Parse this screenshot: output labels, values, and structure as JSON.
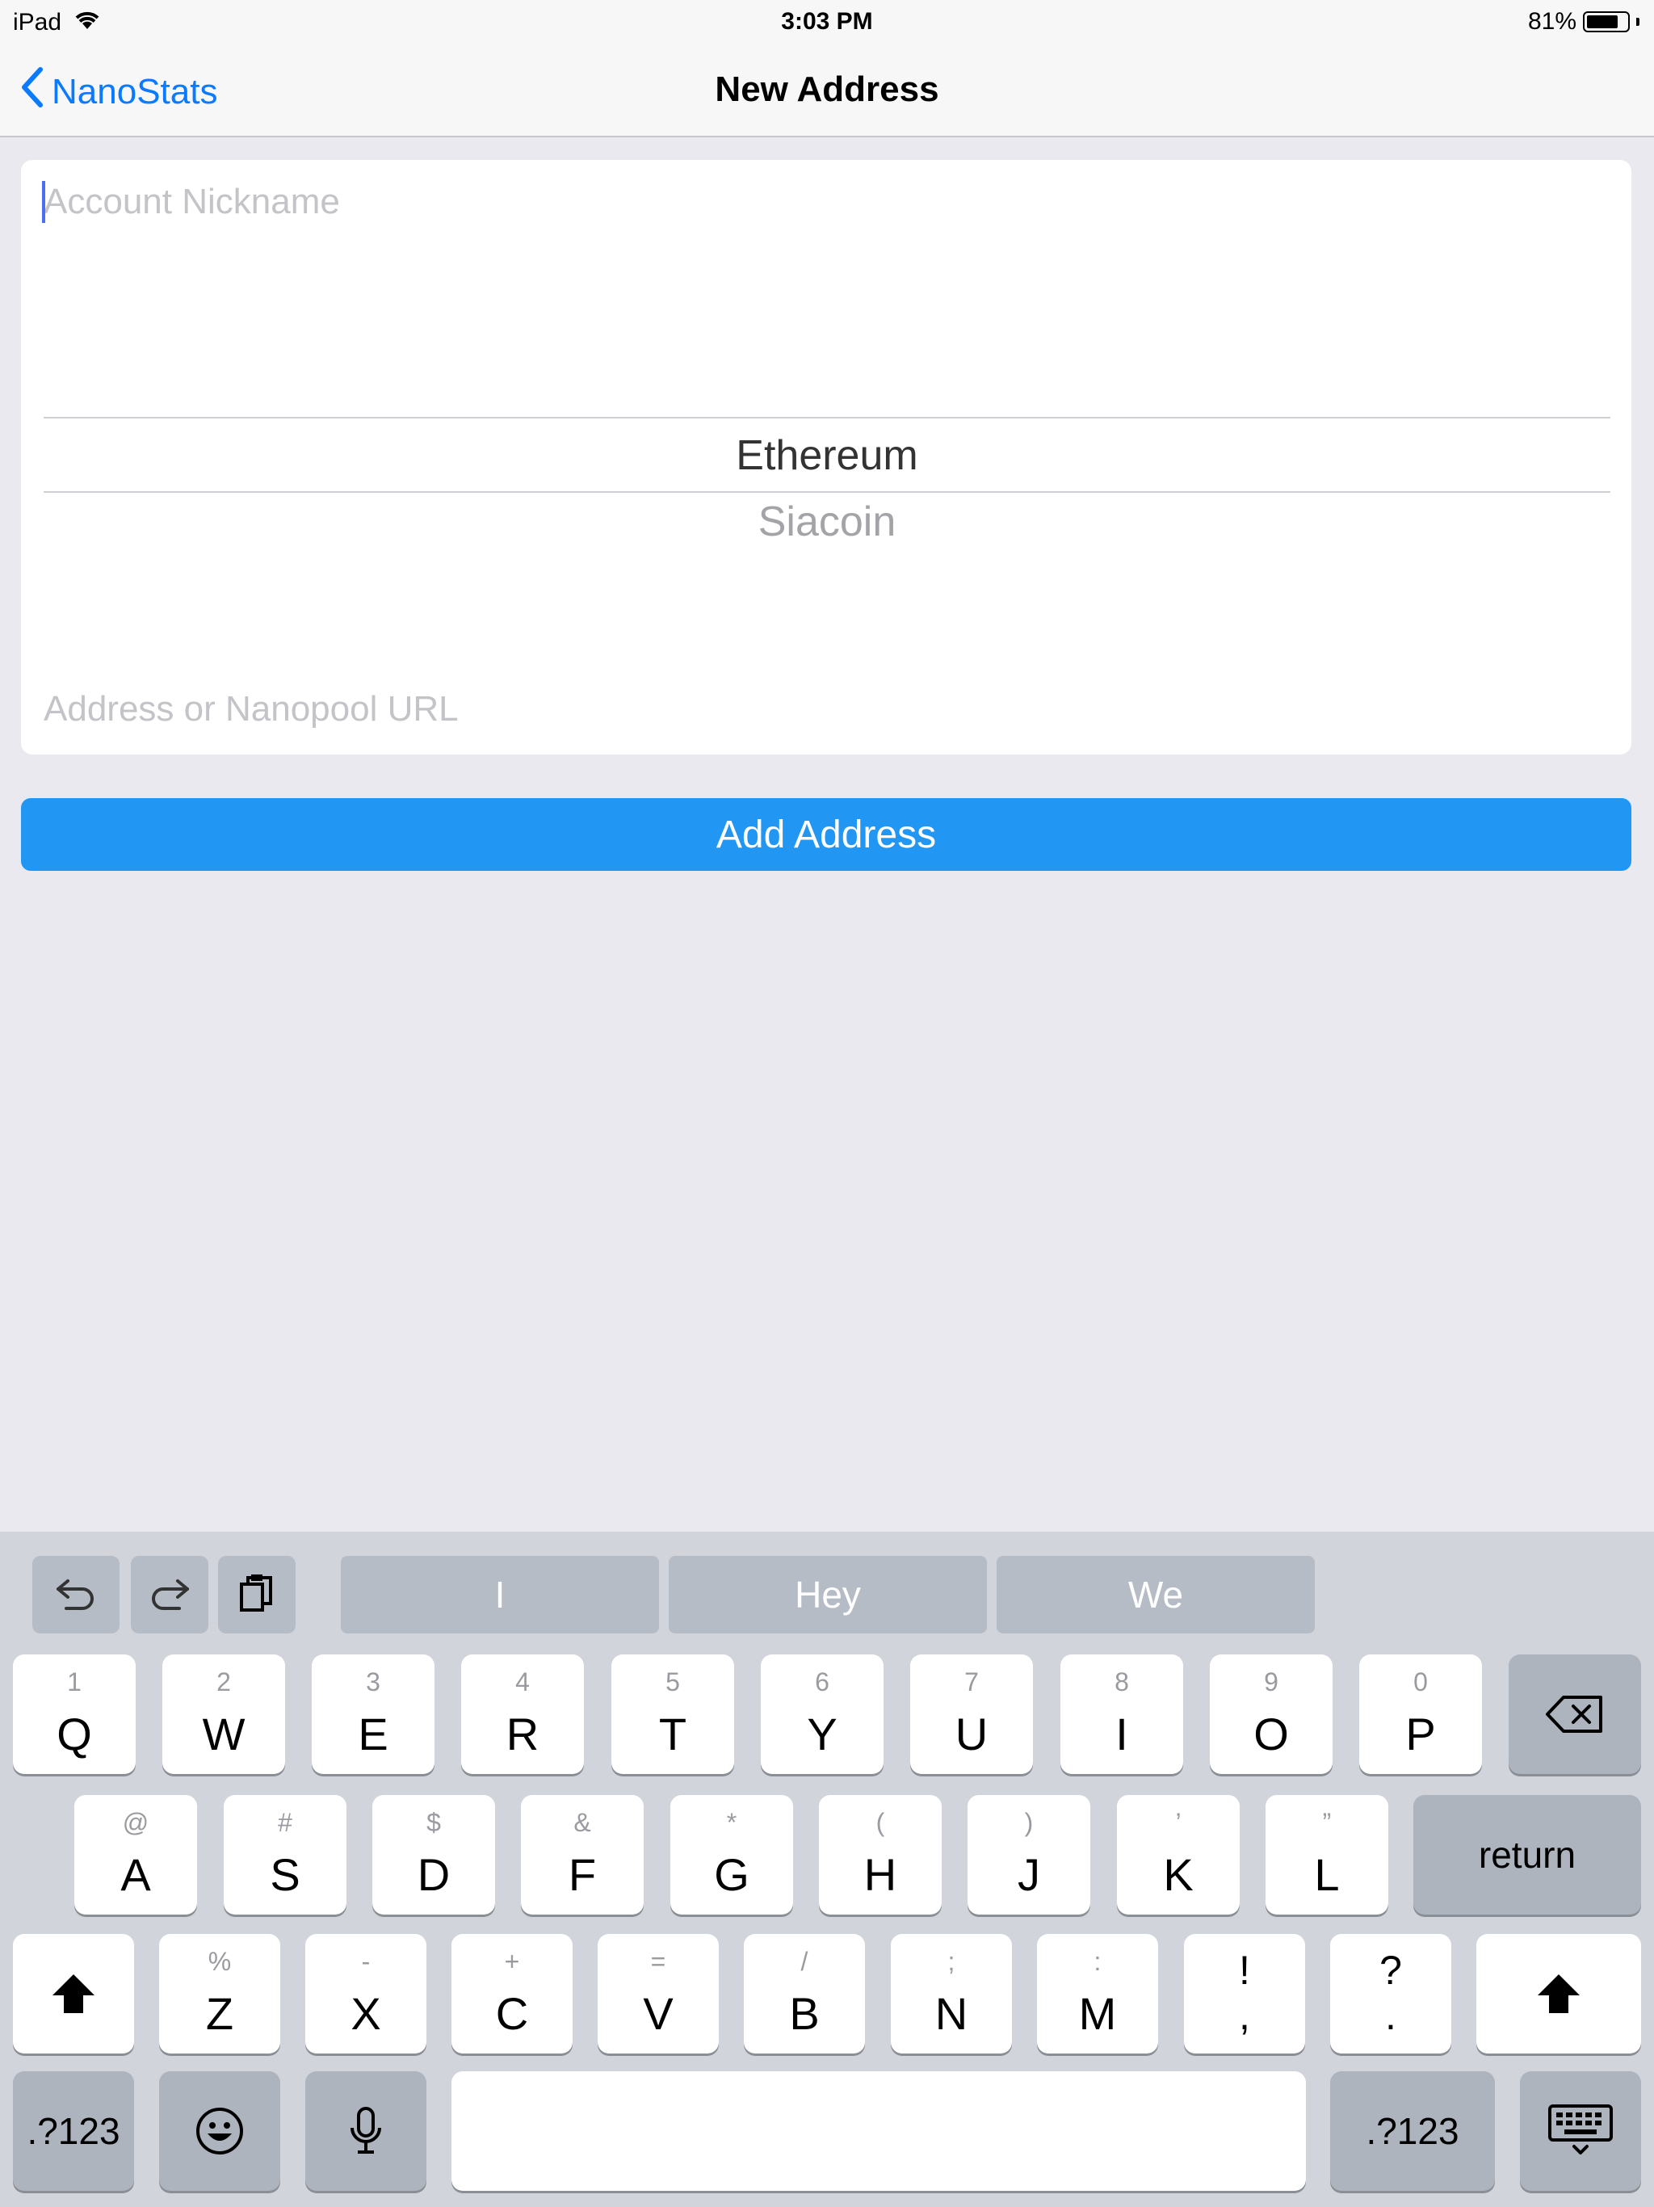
{
  "status_bar": {
    "device": "iPad",
    "time": "3:03 PM",
    "battery_percent": "81%",
    "battery_level": 0.81,
    "wifi_icon": "wifi-icon"
  },
  "nav": {
    "back_label": "NanoStats",
    "title": "New Address"
  },
  "form": {
    "nickname_placeholder": "Account Nickname",
    "nickname_value": "",
    "picker_options": [
      "Ethereum",
      "Siacoin"
    ],
    "picker_selected": "Ethereum",
    "address_placeholder": "Address or Nanopool URL",
    "address_value": ""
  },
  "actions": {
    "add_label": "Add Address"
  },
  "colors": {
    "accent": "#0a7aff",
    "button_bg": "#2196f3",
    "background": "#e9e9ef",
    "keyboard_bg": "#d1d5db"
  },
  "keyboard": {
    "tools": [
      "undo-icon",
      "redo-icon",
      "paste-icon"
    ],
    "suggestions": [
      "I",
      "Hey",
      "We"
    ],
    "row1": [
      {
        "secondary": "1",
        "primary": "Q"
      },
      {
        "secondary": "2",
        "primary": "W"
      },
      {
        "secondary": "3",
        "primary": "E"
      },
      {
        "secondary": "4",
        "primary": "R"
      },
      {
        "secondary": "5",
        "primary": "T"
      },
      {
        "secondary": "6",
        "primary": "Y"
      },
      {
        "secondary": "7",
        "primary": "U"
      },
      {
        "secondary": "8",
        "primary": "I"
      },
      {
        "secondary": "9",
        "primary": "O"
      },
      {
        "secondary": "0",
        "primary": "P"
      }
    ],
    "row2": [
      {
        "secondary": "@",
        "primary": "A"
      },
      {
        "secondary": "#",
        "primary": "S"
      },
      {
        "secondary": "$",
        "primary": "D"
      },
      {
        "secondary": "&",
        "primary": "F"
      },
      {
        "secondary": "*",
        "primary": "G"
      },
      {
        "secondary": "(",
        "primary": "H"
      },
      {
        "secondary": ")",
        "primary": "J"
      },
      {
        "secondary": "’",
        "primary": "K"
      },
      {
        "secondary": "”",
        "primary": "L"
      }
    ],
    "return_label": "return",
    "row3": [
      {
        "secondary": "%",
        "primary": "Z"
      },
      {
        "secondary": "-",
        "primary": "X"
      },
      {
        "secondary": "+",
        "primary": "C"
      },
      {
        "secondary": "=",
        "primary": "V"
      },
      {
        "secondary": "/",
        "primary": "B"
      },
      {
        "secondary": ";",
        "primary": "N"
      },
      {
        "secondary": ":",
        "primary": "M"
      }
    ],
    "punct1": {
      "top": "!",
      "bottom": ","
    },
    "punct2": {
      "top": "?",
      "bottom": "."
    },
    "numbers_label": ".?123"
  }
}
